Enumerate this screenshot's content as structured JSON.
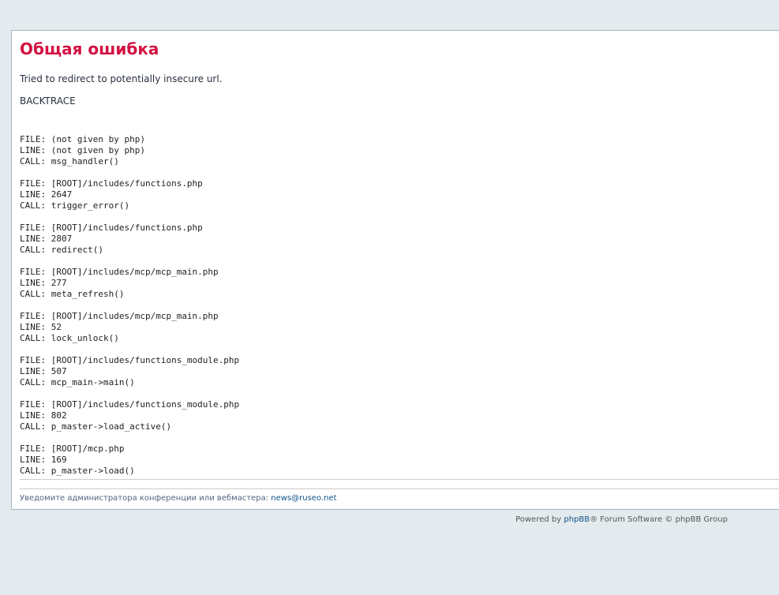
{
  "page": {
    "title": "Общая ошибка",
    "message": "Tried to redirect to potentially insecure url.",
    "backtrace_label": "BACKTRACE"
  },
  "backtrace": [
    {
      "file_label": "FILE:",
      "file": "(not given by php)",
      "line_label": "LINE:",
      "line": "(not given by php)",
      "call_label": "CALL:",
      "call": "msg_handler()"
    },
    {
      "file_label": "FILE:",
      "file": "[ROOT]/includes/functions.php",
      "line_label": "LINE:",
      "line": "2647",
      "call_label": "CALL:",
      "call": "trigger_error()"
    },
    {
      "file_label": "FILE:",
      "file": "[ROOT]/includes/functions.php",
      "line_label": "LINE:",
      "line": "2807",
      "call_label": "CALL:",
      "call": "redirect()"
    },
    {
      "file_label": "FILE:",
      "file": "[ROOT]/includes/mcp/mcp_main.php",
      "line_label": "LINE:",
      "line": "277",
      "call_label": "CALL:",
      "call": "meta_refresh()"
    },
    {
      "file_label": "FILE:",
      "file": "[ROOT]/includes/mcp/mcp_main.php",
      "line_label": "LINE:",
      "line": "52",
      "call_label": "CALL:",
      "call": "lock_unlock()"
    },
    {
      "file_label": "FILE:",
      "file": "[ROOT]/includes/functions_module.php",
      "line_label": "LINE:",
      "line": "507",
      "call_label": "CALL:",
      "call": "mcp_main->main()"
    },
    {
      "file_label": "FILE:",
      "file": "[ROOT]/includes/functions_module.php",
      "line_label": "LINE:",
      "line": "802",
      "call_label": "CALL:",
      "call": "p_master->load_active()"
    },
    {
      "file_label": "FILE:",
      "file": "[ROOT]/mcp.php",
      "line_label": "LINE:",
      "line": "169",
      "call_label": "CALL:",
      "call": "p_master->load()"
    }
  ],
  "notice": {
    "text": "Уведомите администратора конференции или вебмастера: ",
    "email": "news@ruseo.net"
  },
  "footer": {
    "prefix": "Powered by ",
    "link": "phpBB",
    "suffix": "® Forum Software © phpBB Group"
  },
  "colors": {
    "title": "#d31141",
    "link": "#105289",
    "background": "#e4ebee"
  }
}
